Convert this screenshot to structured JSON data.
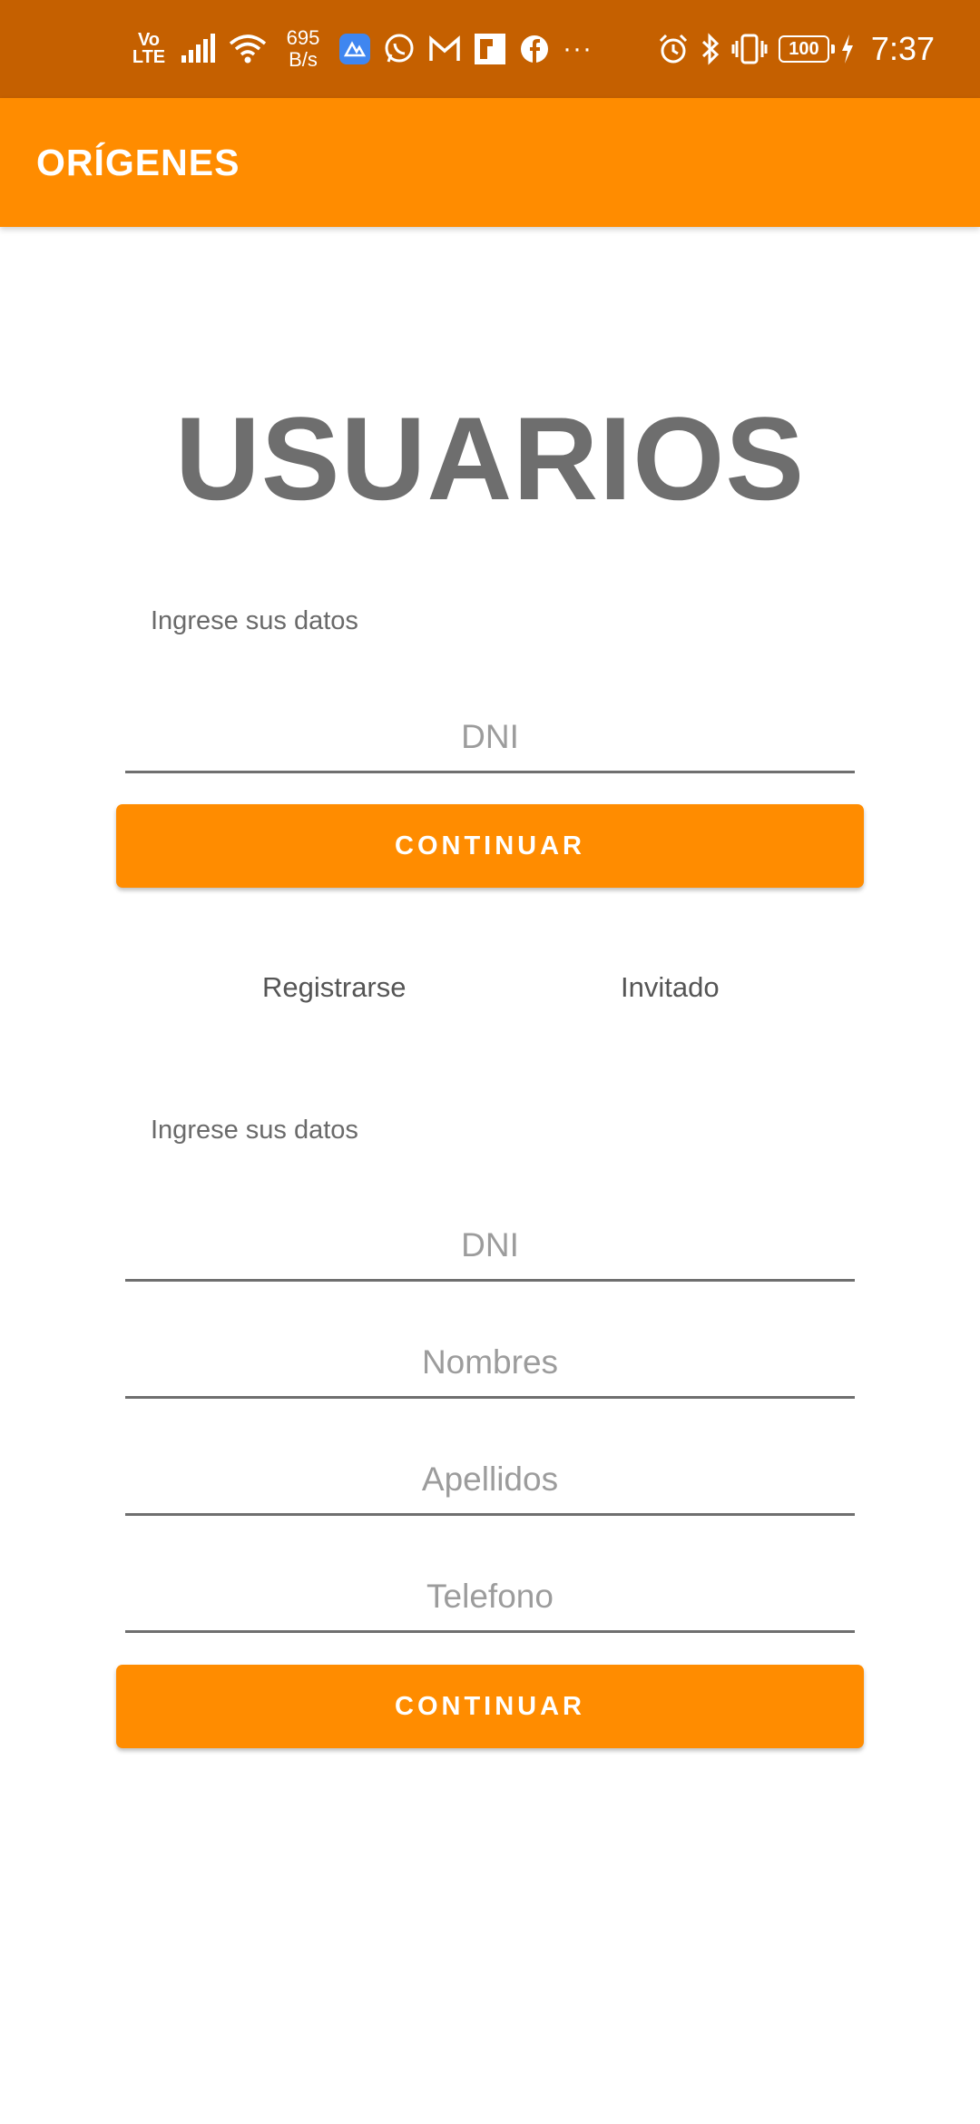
{
  "status_bar": {
    "volte_top": "Vo",
    "volte_bottom": "LTE",
    "net_speed_value": "695",
    "net_speed_unit": "B/s",
    "notification_icons": [
      "signal-icon",
      "wifi-icon",
      "app-icon",
      "whatsapp-icon",
      "gmail-icon",
      "app-tile-icon",
      "facebook-icon"
    ],
    "more_notifications": "···",
    "battery_level": "100",
    "time": "7:37",
    "bg_color": "#c56000"
  },
  "app_bar": {
    "title": "ORÍGENES",
    "bg_color": "#ff8c00"
  },
  "main": {
    "heading": "USUARIOS"
  },
  "login": {
    "prompt": "Ingrese sus datos",
    "dni_placeholder": "DNI",
    "continue_label": "CONTINUAR"
  },
  "links": {
    "register": "Registrarse",
    "guest": "Invitado"
  },
  "register_form": {
    "prompt": "Ingrese sus datos",
    "dni_placeholder": "DNI",
    "names_placeholder": "Nombres",
    "surnames_placeholder": "Apellidos",
    "phone_placeholder": "Telefono",
    "continue_label": "CONTINUAR"
  }
}
